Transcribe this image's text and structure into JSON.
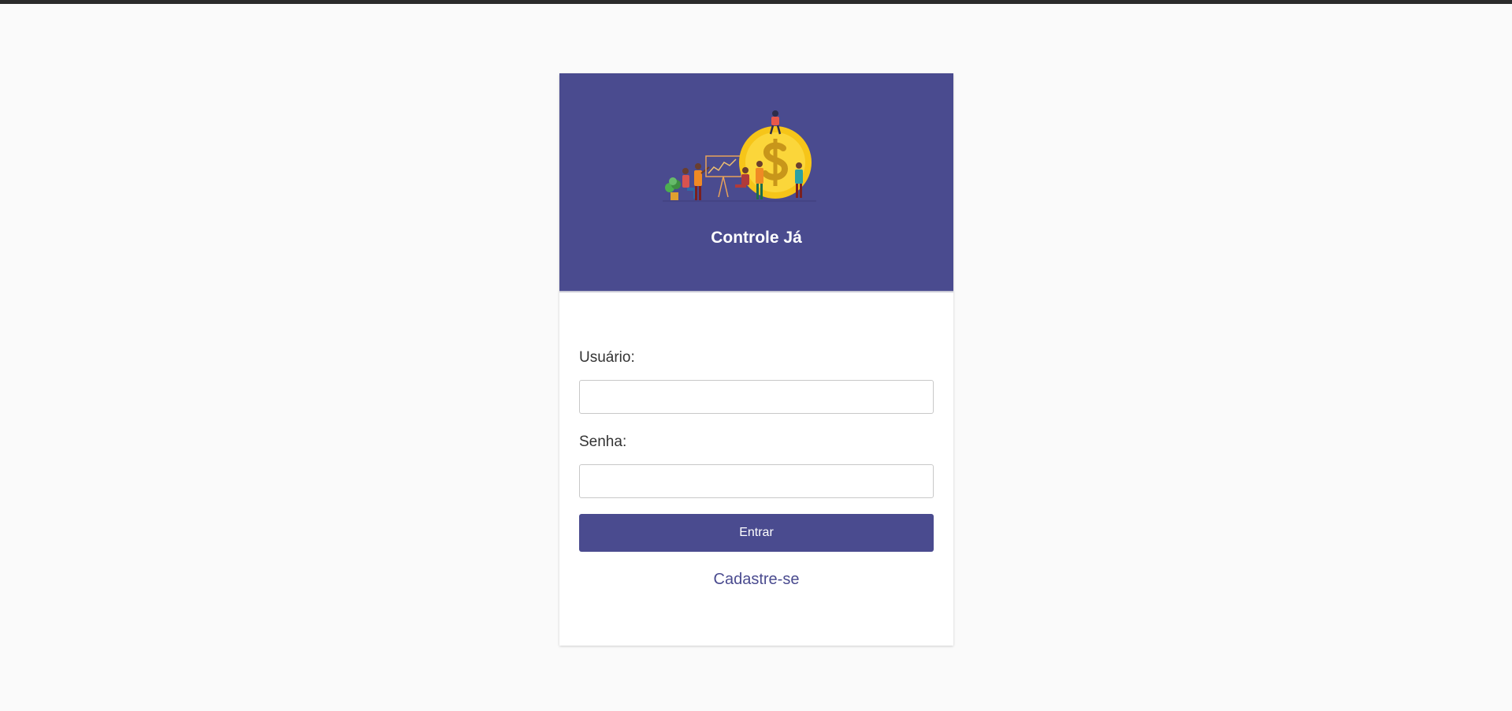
{
  "app": {
    "title": "Controle Já"
  },
  "form": {
    "username_label": "Usuário:",
    "username_value": "",
    "password_label": "Senha:",
    "password_value": "",
    "submit_label": "Entrar",
    "register_link": "Cadastre-se"
  },
  "icons": {
    "header_illustration": "finance-team-coin-illustration"
  },
  "colors": {
    "brand": "#4a4b8f",
    "page_background": "#fafafa",
    "coin": "#f6c519"
  }
}
